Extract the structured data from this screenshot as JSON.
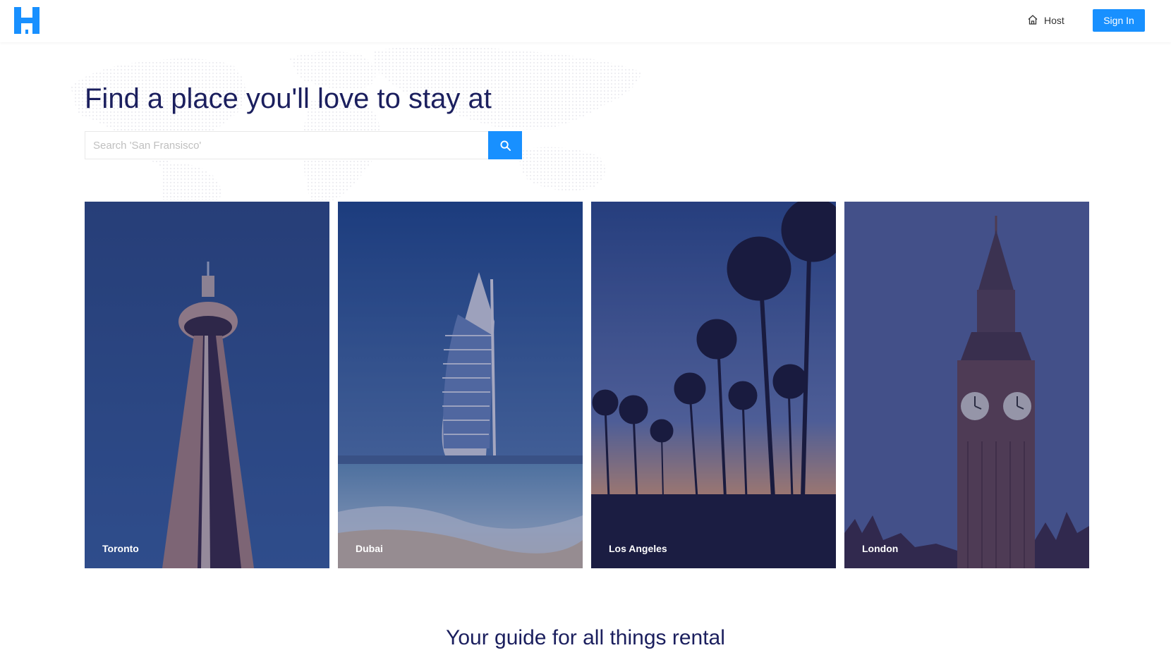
{
  "header": {
    "logo_icon": "house-h-logo-icon",
    "host_label": "Host",
    "host_icon": "home-icon",
    "signin_label": "Sign In"
  },
  "hero": {
    "title": "Find a place you'll love to stay at",
    "search_placeholder": "Search 'San Fransisco'",
    "search_icon": "search-icon"
  },
  "cards": [
    {
      "city": "Toronto"
    },
    {
      "city": "Dubai"
    },
    {
      "city": "Los Angeles"
    },
    {
      "city": "London"
    }
  ],
  "guide": {
    "title": "Your guide for all things rental"
  },
  "colors": {
    "accent": "#1890ff",
    "heading": "#1b1f5e"
  }
}
